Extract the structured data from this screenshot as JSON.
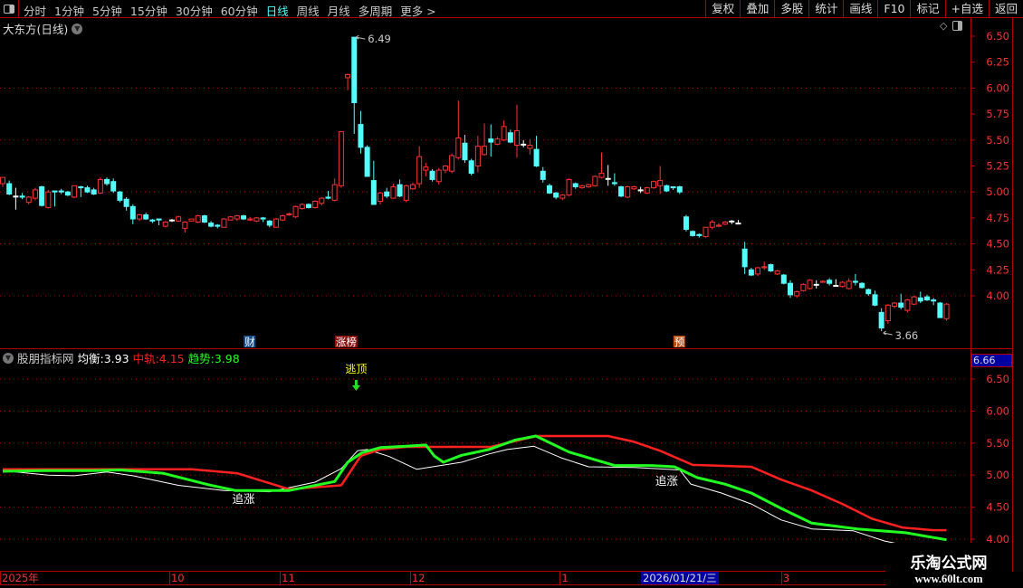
{
  "toolbar": {
    "periods": [
      "分时",
      "1分钟",
      "5分钟",
      "15分钟",
      "30分钟",
      "60分钟",
      "日线",
      "周线",
      "月线",
      "多周期",
      "更多 >"
    ],
    "active": "日线",
    "buttons": [
      "复权",
      "叠加",
      "多股",
      "统计",
      "画线",
      "F10",
      "标记",
      "+自选",
      "返回"
    ]
  },
  "main": {
    "title": "大东方(日线)",
    "price_ticks": [
      "6.50",
      "6.25",
      "6.00",
      "5.75",
      "5.50",
      "5.25",
      "5.00",
      "4.75",
      "4.50",
      "4.25",
      "4.00"
    ],
    "high_label": "6.49",
    "low_label": "3.66",
    "badges": [
      {
        "text": "财",
        "color": "#1a4d8a",
        "at": 38
      },
      {
        "text": "涨榜",
        "color": "#8b1010",
        "at": 52
      },
      {
        "text": "预",
        "color": "#b84a10",
        "at": 104
      }
    ]
  },
  "indicator": {
    "name": "股朋指标网",
    "items": [
      {
        "label": "均衡:",
        "value": "3.93",
        "color": "#ffffff"
      },
      {
        "label": "中轨:",
        "value": "4.15",
        "color": "#ff2020"
      },
      {
        "label": "趋势:",
        "value": "3.98",
        "color": "#20ff20"
      }
    ],
    "current": "6.66",
    "ticks": [
      "6.50",
      "6.00",
      "5.50",
      "5.00",
      "4.50",
      "4.00"
    ],
    "signal_top": "逃顶",
    "signal_chase": "追涨"
  },
  "time_axis": {
    "labels": [
      {
        "t": "2025年",
        "at": 0
      },
      {
        "t": "10",
        "at": 26
      },
      {
        "t": "11",
        "at": 43
      },
      {
        "t": "12",
        "at": 63
      },
      {
        "t": "1",
        "at": 86
      },
      {
        "t": "3",
        "at": 120
      }
    ],
    "selected": "2026/01/21/三"
  },
  "watermark": {
    "name": "乐淘公式网",
    "url": "www.60lt.com"
  },
  "colors": {
    "up": "#ff3232",
    "down": "#54fcfc",
    "flat": "#ffffff",
    "grid": "#b00000"
  },
  "chart_data": {
    "type": "candlestick",
    "fields": [
      "open",
      "high",
      "low",
      "close"
    ],
    "candles": [
      [
        5.08,
        5.14,
        5.05,
        5.14
      ],
      [
        5.08,
        5.11,
        4.97,
        4.98
      ],
      [
        4.96,
        5.04,
        4.83,
        4.96
      ],
      [
        4.96,
        4.99,
        4.93,
        4.95
      ],
      [
        4.9,
        4.96,
        4.88,
        4.95
      ],
      [
        4.94,
        5.04,
        4.92,
        5.02
      ],
      [
        5.05,
        5.06,
        4.86,
        4.87
      ],
      [
        4.85,
        5.02,
        4.84,
        5.0
      ],
      [
        5.01,
        5.01,
        4.86,
        5.0
      ],
      [
        5.01,
        5.03,
        4.98,
        5.0
      ],
      [
        5.0,
        5.01,
        4.96,
        4.97
      ],
      [
        4.95,
        5.06,
        4.94,
        5.06
      ],
      [
        5.05,
        5.06,
        4.95,
        5.04
      ],
      [
        5.04,
        5.06,
        4.99,
        5.0
      ],
      [
        5.02,
        5.04,
        4.97,
        4.98
      ],
      [
        4.99,
        5.14,
        4.98,
        5.12
      ],
      [
        5.12,
        5.14,
        5.06,
        5.08
      ],
      [
        5.1,
        5.13,
        4.99,
        5.01
      ],
      [
        5.0,
        5.01,
        4.9,
        4.92
      ],
      [
        4.93,
        4.95,
        4.82,
        4.86
      ],
      [
        4.86,
        4.88,
        4.69,
        4.74
      ],
      [
        4.74,
        4.79,
        4.72,
        4.78
      ],
      [
        4.78,
        4.8,
        4.73,
        4.74
      ],
      [
        4.73,
        4.74,
        4.7,
        4.72
      ],
      [
        4.74,
        4.74,
        4.68,
        4.73
      ],
      [
        4.67,
        4.72,
        4.66,
        4.71
      ],
      [
        4.73,
        4.74,
        4.71,
        4.73
      ],
      [
        4.72,
        4.77,
        4.71,
        4.76
      ],
      [
        4.65,
        4.72,
        4.61,
        4.71
      ],
      [
        4.72,
        4.74,
        4.72,
        4.74
      ],
      [
        4.71,
        4.78,
        4.7,
        4.77
      ],
      [
        4.77,
        4.78,
        4.7,
        4.71
      ],
      [
        4.7,
        4.72,
        4.66,
        4.67
      ],
      [
        4.68,
        4.69,
        4.65,
        4.67
      ],
      [
        4.66,
        4.75,
        4.66,
        4.74
      ],
      [
        4.73,
        4.77,
        4.73,
        4.76
      ],
      [
        4.74,
        4.78,
        4.72,
        4.77
      ],
      [
        4.77,
        4.78,
        4.73,
        4.74
      ],
      [
        4.73,
        4.76,
        4.72,
        4.74
      ],
      [
        4.72,
        4.76,
        4.71,
        4.75
      ],
      [
        4.75,
        4.76,
        4.71,
        4.74
      ],
      [
        4.72,
        4.73,
        4.66,
        4.68
      ],
      [
        4.66,
        4.75,
        4.66,
        4.74
      ],
      [
        4.73,
        4.78,
        4.72,
        4.77
      ],
      [
        4.78,
        4.8,
        4.77,
        4.79
      ],
      [
        4.76,
        4.87,
        4.75,
        4.86
      ],
      [
        4.84,
        4.89,
        4.83,
        4.88
      ],
      [
        4.88,
        4.89,
        4.84,
        4.85
      ],
      [
        4.85,
        4.92,
        4.84,
        4.91
      ],
      [
        4.89,
        4.95,
        4.87,
        4.94
      ],
      [
        4.95,
        5.01,
        4.93,
        4.94
      ],
      [
        4.92,
        5.13,
        4.91,
        5.07
      ],
      [
        5.06,
        5.58,
        5.04,
        5.58
      ],
      [
        6.1,
        6.14,
        5.98,
        6.13
      ],
      [
        6.49,
        6.49,
        5.56,
        5.86
      ],
      [
        5.65,
        5.78,
        5.37,
        5.43
      ],
      [
        5.43,
        5.45,
        5.15,
        5.15
      ],
      [
        5.11,
        5.3,
        4.88,
        4.88
      ],
      [
        4.91,
        5.0,
        4.88,
        4.99
      ],
      [
        5.0,
        5.04,
        4.94,
        4.96
      ],
      [
        4.94,
        5.08,
        4.94,
        5.05
      ],
      [
        5.07,
        5.12,
        4.95,
        4.96
      ],
      [
        4.92,
        5.07,
        4.9,
        5.06
      ],
      [
        5.03,
        5.09,
        5.02,
        5.07
      ],
      [
        5.08,
        5.44,
        5.04,
        5.34
      ],
      [
        5.21,
        5.28,
        5.15,
        5.24
      ],
      [
        5.2,
        5.22,
        5.1,
        5.12
      ],
      [
        5.1,
        5.23,
        5.07,
        5.21
      ],
      [
        5.21,
        5.26,
        5.18,
        5.25
      ],
      [
        5.2,
        5.37,
        5.18,
        5.35
      ],
      [
        5.33,
        5.88,
        5.31,
        5.52
      ],
      [
        5.47,
        5.55,
        5.28,
        5.31
      ],
      [
        5.3,
        5.32,
        5.16,
        5.18
      ],
      [
        5.25,
        5.54,
        5.19,
        5.44
      ],
      [
        5.36,
        5.66,
        5.35,
        5.44
      ],
      [
        5.51,
        5.65,
        5.34,
        5.48
      ],
      [
        5.46,
        5.53,
        5.45,
        5.51
      ],
      [
        5.5,
        5.69,
        5.49,
        5.63
      ],
      [
        5.57,
        5.6,
        5.47,
        5.48
      ],
      [
        5.45,
        5.84,
        5.33,
        5.59
      ],
      [
        5.46,
        5.5,
        5.43,
        5.46
      ],
      [
        5.42,
        5.51,
        5.36,
        5.45
      ],
      [
        5.41,
        5.54,
        5.24,
        5.25
      ],
      [
        5.2,
        5.24,
        5.09,
        5.12
      ],
      [
        5.06,
        5.08,
        4.98,
        4.99
      ],
      [
        4.99,
        5.0,
        4.93,
        4.95
      ],
      [
        4.94,
        4.98,
        4.92,
        4.97
      ],
      [
        4.97,
        5.13,
        4.96,
        5.12
      ],
      [
        5.08,
        5.09,
        5.03,
        5.05
      ],
      [
        5.04,
        5.07,
        5.03,
        5.06
      ],
      [
        5.05,
        5.08,
        5.04,
        5.07
      ],
      [
        5.06,
        5.16,
        5.05,
        5.15
      ],
      [
        5.14,
        5.38,
        5.13,
        5.18
      ],
      [
        5.13,
        5.26,
        5.06,
        5.13
      ],
      [
        5.09,
        5.18,
        5.06,
        5.08
      ],
      [
        5.05,
        5.06,
        4.95,
        4.96
      ],
      [
        4.95,
        5.06,
        4.94,
        5.05
      ],
      [
        5.03,
        5.06,
        5.02,
        5.05
      ],
      [
        5.02,
        5.05,
        4.99,
        5.02
      ],
      [
        4.99,
        5.05,
        4.98,
        5.04
      ],
      [
        5.04,
        5.11,
        5.03,
        5.1
      ],
      [
        5.06,
        5.25,
        4.98,
        5.11
      ],
      [
        5.06,
        5.07,
        5.0,
        5.01
      ],
      [
        5.05,
        5.05,
        5.02,
        5.04
      ],
      [
        5.05,
        5.06,
        4.98,
        5.0
      ],
      [
        4.76,
        4.78,
        4.62,
        4.64
      ],
      [
        4.62,
        4.63,
        4.57,
        4.58
      ],
      [
        4.59,
        4.6,
        4.56,
        4.58
      ],
      [
        4.57,
        4.66,
        4.56,
        4.66
      ],
      [
        4.66,
        4.73,
        4.64,
        4.71
      ],
      [
        4.67,
        4.7,
        4.66,
        4.68
      ],
      [
        4.69,
        4.72,
        4.68,
        4.71
      ],
      [
        4.72,
        4.73,
        4.69,
        4.72
      ],
      [
        4.7,
        4.73,
        4.7,
        4.7
      ],
      [
        4.45,
        4.52,
        4.21,
        4.28
      ],
      [
        4.25,
        4.27,
        4.19,
        4.2
      ],
      [
        4.21,
        4.28,
        4.19,
        4.27
      ],
      [
        4.27,
        4.33,
        4.25,
        4.28
      ],
      [
        4.3,
        4.31,
        4.23,
        4.24
      ],
      [
        4.21,
        4.25,
        4.2,
        4.24
      ],
      [
        4.2,
        4.21,
        4.11,
        4.12
      ],
      [
        4.12,
        4.15,
        3.98,
        4.01
      ],
      [
        4.0,
        4.05,
        3.98,
        4.04
      ],
      [
        4.05,
        4.12,
        4.04,
        4.11
      ],
      [
        4.07,
        4.16,
        4.06,
        4.15
      ],
      [
        4.11,
        4.15,
        4.07,
        4.11
      ],
      [
        4.13,
        4.15,
        4.13,
        4.14
      ],
      [
        4.15,
        4.17,
        4.1,
        4.12
      ],
      [
        4.1,
        4.16,
        4.1,
        4.1
      ],
      [
        4.09,
        4.14,
        4.08,
        4.13
      ],
      [
        4.07,
        4.17,
        4.06,
        4.14
      ],
      [
        4.14,
        4.21,
        4.1,
        4.13
      ],
      [
        4.12,
        4.13,
        4.07,
        4.08
      ],
      [
        4.06,
        4.07,
        4.0,
        4.02
      ],
      [
        4.01,
        4.05,
        3.9,
        3.91
      ],
      [
        3.84,
        3.88,
        3.66,
        3.69
      ],
      [
        3.76,
        3.92,
        3.73,
        3.91
      ],
      [
        3.9,
        3.94,
        3.88,
        3.93
      ],
      [
        3.93,
        4.02,
        3.87,
        3.89
      ],
      [
        3.86,
        3.97,
        3.84,
        3.96
      ],
      [
        3.92,
        4.0,
        3.91,
        3.99
      ],
      [
        3.98,
        4.04,
        3.93,
        3.95
      ],
      [
        3.99,
        4.01,
        3.95,
        3.96
      ],
      [
        3.96,
        3.98,
        3.91,
        3.95
      ],
      [
        3.93,
        3.94,
        3.79,
        3.79
      ],
      [
        3.78,
        3.93,
        3.76,
        3.92
      ]
    ],
    "indicator_series": [
      {
        "name": "均衡",
        "color": "#ffffff",
        "points": [
          [
            0,
            5.07
          ],
          [
            7,
            5.0
          ],
          [
            11,
            4.99
          ],
          [
            16,
            5.05
          ],
          [
            20,
            4.99
          ],
          [
            27,
            4.84
          ],
          [
            34,
            4.76
          ],
          [
            41,
            4.74
          ],
          [
            48,
            4.89
          ],
          [
            52,
            5.1
          ],
          [
            54.5,
            5.38
          ],
          [
            56,
            5.4
          ],
          [
            59.4,
            5.29
          ],
          [
            63.6,
            5.09
          ],
          [
            70.5,
            5.2
          ],
          [
            74.7,
            5.33
          ],
          [
            77.5,
            5.4
          ],
          [
            81.6,
            5.45
          ],
          [
            85.8,
            5.27
          ],
          [
            90,
            5.13
          ],
          [
            97,
            5.12
          ],
          [
            104,
            5.08
          ],
          [
            105.7,
            4.86
          ],
          [
            110.4,
            4.72
          ],
          [
            115,
            4.55
          ],
          [
            119.6,
            4.3
          ],
          [
            124.3,
            4.16
          ],
          [
            130.7,
            4.13
          ],
          [
            135.5,
            3.97
          ],
          [
            137.5,
            3.93
          ]
        ]
      },
      {
        "name": "中轨",
        "color": "#ff2020",
        "points": [
          [
            0,
            5.09
          ],
          [
            29,
            5.09
          ],
          [
            36,
            5.03
          ],
          [
            44,
            4.78
          ],
          [
            52,
            4.84
          ],
          [
            55,
            5.3
          ],
          [
            58,
            5.4
          ],
          [
            62,
            5.44
          ],
          [
            75,
            5.44
          ],
          [
            82,
            5.61
          ],
          [
            93,
            5.61
          ],
          [
            97,
            5.52
          ],
          [
            101,
            5.38
          ],
          [
            106,
            5.16
          ],
          [
            115,
            5.13
          ],
          [
            119.6,
            4.93
          ],
          [
            124.3,
            4.76
          ],
          [
            129,
            4.55
          ],
          [
            133.5,
            4.32
          ],
          [
            138.3,
            4.18
          ],
          [
            143,
            4.14
          ],
          [
            145,
            4.14
          ]
        ]
      },
      {
        "name": "趋势",
        "color": "#20ff20",
        "points": [
          [
            0,
            5.06
          ],
          [
            6,
            5.07
          ],
          [
            14,
            5.07
          ],
          [
            18,
            5.08
          ],
          [
            24.6,
            5.03
          ],
          [
            31.6,
            4.85
          ],
          [
            35.7,
            4.76
          ],
          [
            44,
            4.76
          ],
          [
            51,
            4.9
          ],
          [
            53,
            5.2
          ],
          [
            55.2,
            5.35
          ],
          [
            58,
            5.43
          ],
          [
            62,
            5.45
          ],
          [
            65,
            5.47
          ],
          [
            66.3,
            5.3
          ],
          [
            67.7,
            5.2
          ],
          [
            70.5,
            5.31
          ],
          [
            74.7,
            5.4
          ],
          [
            78.8,
            5.55
          ],
          [
            81.9,
            5.61
          ],
          [
            87,
            5.36
          ],
          [
            94,
            5.15
          ],
          [
            99.7,
            5.15
          ],
          [
            103.2,
            5.13
          ],
          [
            106.7,
            4.96
          ],
          [
            110.9,
            4.86
          ],
          [
            115,
            4.72
          ],
          [
            119.6,
            4.48
          ],
          [
            124.3,
            4.25
          ],
          [
            131.3,
            4.16
          ],
          [
            138.7,
            4.1
          ],
          [
            145,
            3.99
          ]
        ]
      }
    ]
  }
}
